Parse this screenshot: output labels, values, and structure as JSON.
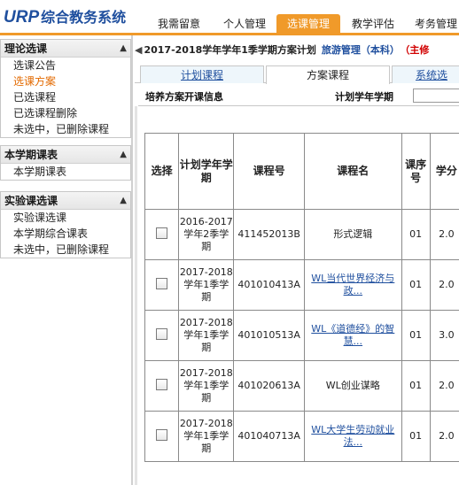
{
  "app": {
    "logo_en": "URP",
    "logo_zh": "综合教务系统"
  },
  "nav": {
    "tabs": [
      {
        "label": "我需留意"
      },
      {
        "label": "个人管理"
      },
      {
        "label": "选课管理",
        "active": true
      },
      {
        "label": "教学评估"
      },
      {
        "label": "考务管理"
      }
    ]
  },
  "sidebar": {
    "sections": [
      {
        "title": "理论选课",
        "items": [
          {
            "label": "选课公告"
          },
          {
            "label": "选课方案",
            "active": true
          },
          {
            "label": "已选课程"
          },
          {
            "label": "已选课程删除"
          },
          {
            "label": "未选中，已删除课程"
          }
        ]
      },
      {
        "title": "本学期课表",
        "items": [
          {
            "label": "本学期课表"
          }
        ]
      },
      {
        "title": "实验课选课",
        "items": [
          {
            "label": "实验课选课"
          },
          {
            "label": "本学期综合课表"
          },
          {
            "label": "未选中，已删除课程"
          }
        ]
      }
    ]
  },
  "plan_bar": {
    "term": "2017-2018学年学年1季学期方案计划",
    "major": "旅游管理（本科）",
    "lead": "（主修"
  },
  "subtabs": [
    {
      "label": "计划课程"
    },
    {
      "label": "方案课程",
      "active": true
    },
    {
      "label": "系统选"
    }
  ],
  "info_bar": {
    "left": "培养方案开课信息",
    "right": "计划学年学期"
  },
  "table": {
    "headers": [
      "选择",
      "计划学年学期",
      "课程号",
      "课程名",
      "课序号",
      "学分"
    ],
    "rows": [
      {
        "term": "2016-2017学年2季学期",
        "code": "411452013B",
        "name": "形式逻辑",
        "seq": "01",
        "credit": "2.0",
        "link": false
      },
      {
        "term": "2017-2018学年1季学期",
        "code": "401010413A",
        "name": "WL当代世界经济与政...",
        "seq": "01",
        "credit": "2.0",
        "link": true
      },
      {
        "term": "2017-2018学年1季学期",
        "code": "401010513A",
        "name": "WL《道德经》的智慧...",
        "seq": "01",
        "credit": "3.0",
        "link": true
      },
      {
        "term": "2017-2018学年1季学期",
        "code": "401020613A",
        "name": "WL创业谋略",
        "seq": "01",
        "credit": "2.0",
        "link": false
      },
      {
        "term": "2017-2018学年1季学期",
        "code": "401040713A",
        "name": "WL大学生劳动就业法...",
        "seq": "01",
        "credit": "2.0",
        "link": true
      }
    ]
  }
}
